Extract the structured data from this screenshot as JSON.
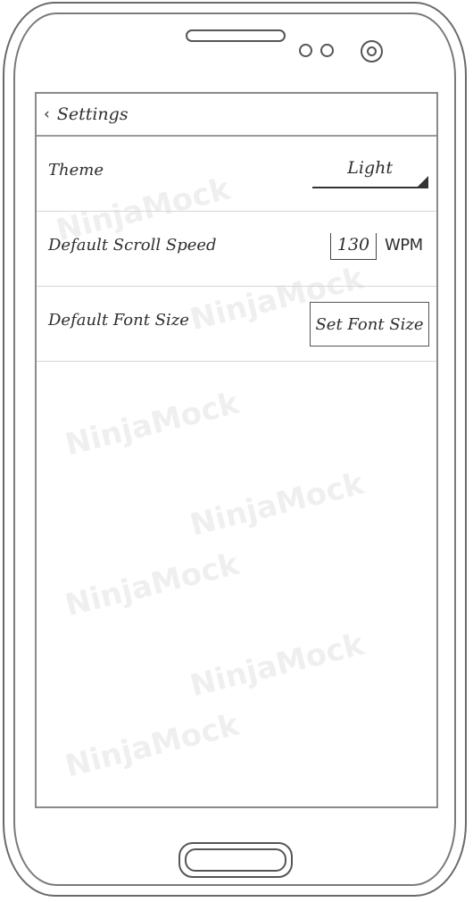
{
  "watermark": {
    "text": "NinjaMock"
  },
  "header": {
    "back_icon": "‹",
    "title": "Settings"
  },
  "settings": {
    "theme": {
      "label": "Theme",
      "value": "Light"
    },
    "scroll_speed": {
      "label": "Default Scroll Speed",
      "value": "130",
      "unit": "WPM"
    },
    "font_size": {
      "label": "Default Font Size",
      "button_label": "Set Font Size"
    }
  }
}
